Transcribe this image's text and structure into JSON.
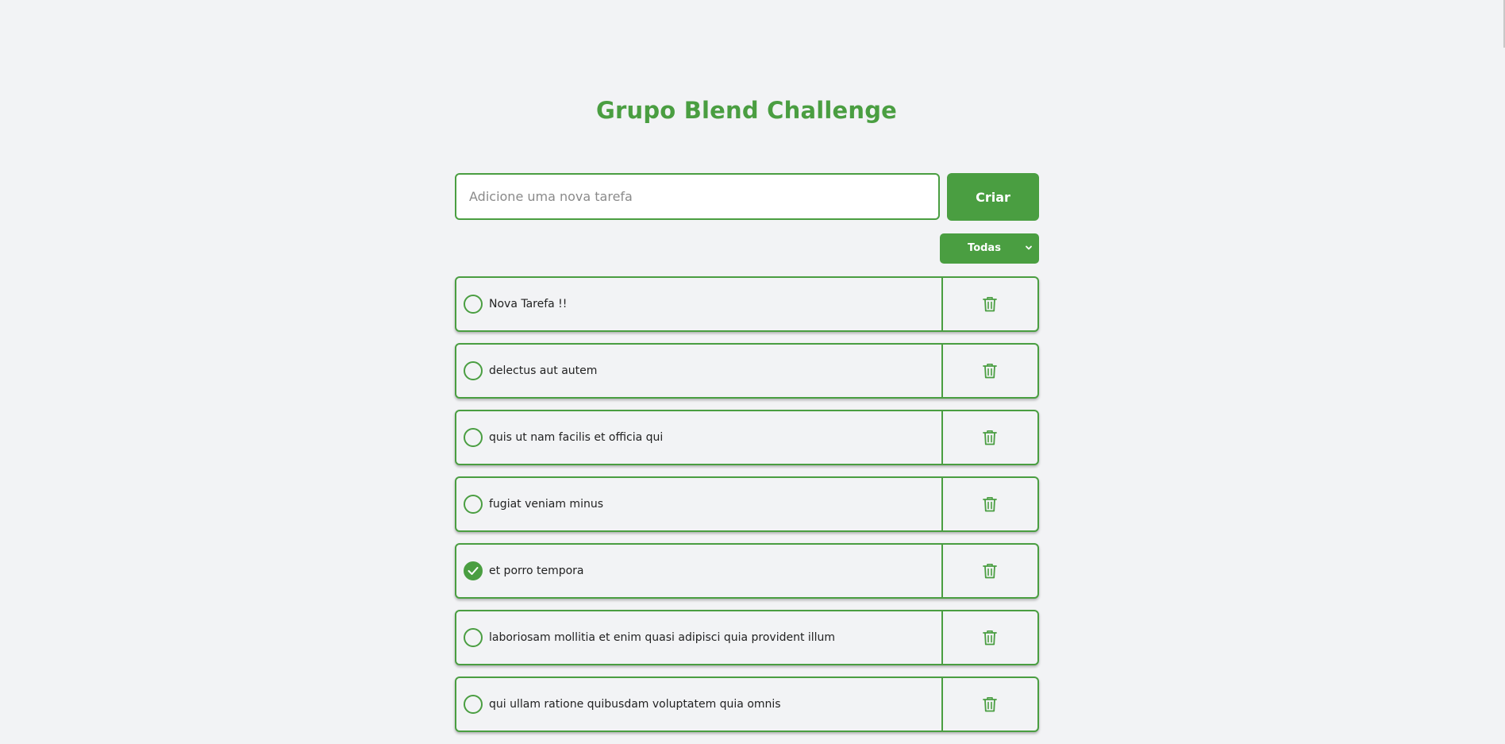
{
  "app": {
    "title": "Grupo Blend Challenge"
  },
  "form": {
    "placeholder": "Adicione uma nova tarefa",
    "value": "",
    "create_label": "Criar"
  },
  "filter": {
    "selected": "Todas"
  },
  "icons": {
    "check": "check-icon",
    "delete": "trash-icon",
    "dropdown": "chevron-down-icon"
  },
  "colors": {
    "accent": "#4a9e41",
    "background": "#f2f3f5"
  },
  "tasks": [
    {
      "text": "Nova Tarefa !!",
      "done": false
    },
    {
      "text": "delectus aut autem",
      "done": false
    },
    {
      "text": "quis ut nam facilis et officia qui",
      "done": false
    },
    {
      "text": "fugiat veniam minus",
      "done": false
    },
    {
      "text": "et porro tempora",
      "done": true
    },
    {
      "text": "laboriosam mollitia et enim quasi adipisci quia provident illum",
      "done": false
    },
    {
      "text": "qui ullam ratione quibusdam voluptatem quia omnis",
      "done": false
    }
  ]
}
